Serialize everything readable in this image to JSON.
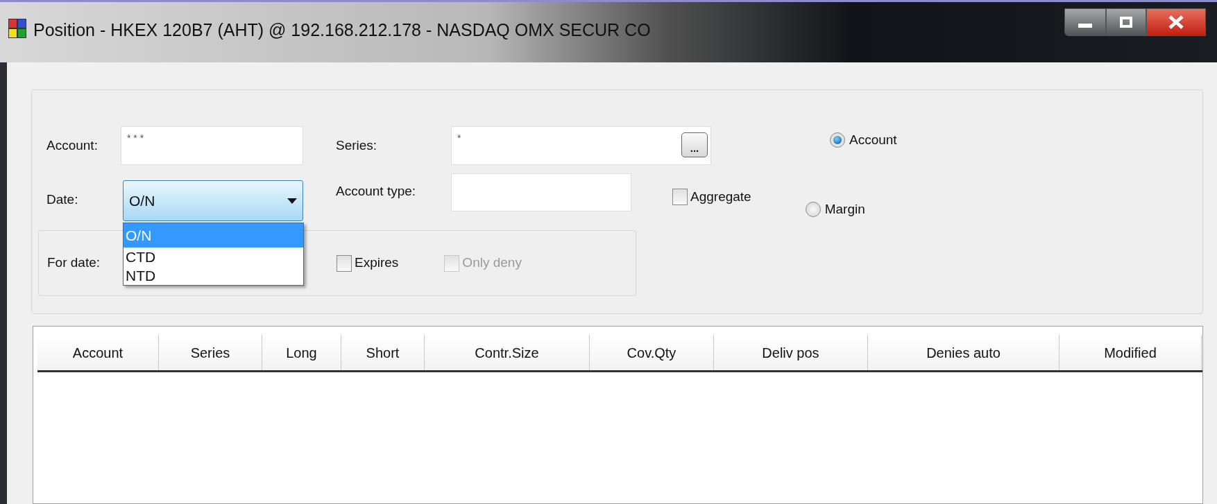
{
  "window": {
    "title": "Position - HKEX 120B7 (AHT) @ 192.168.212.178 - NASDAQ OMX SECUR CO"
  },
  "filters": {
    "account": {
      "label": "Account:",
      "value": "* * *"
    },
    "series": {
      "label": "Series:",
      "value": "*",
      "button": "..."
    },
    "date": {
      "label": "Date:",
      "value": "O/N",
      "expanded": true,
      "options": [
        {
          "label": "O/N",
          "selected": true
        },
        {
          "label": "CTD",
          "selected": false
        },
        {
          "label": "NTD",
          "selected": false
        }
      ]
    },
    "account_type": {
      "label": "Account type:"
    },
    "aggregate": {
      "label": "Aggregate",
      "checked": false,
      "disabled": false
    },
    "for_date": {
      "label": "For date:"
    },
    "expires": {
      "label": "Expires",
      "checked": false,
      "disabled": false
    },
    "only_deny": {
      "label": "Only deny",
      "checked": false,
      "disabled": true
    },
    "mode": [
      {
        "label": "Account",
        "selected": true
      },
      {
        "label": "Margin",
        "selected": false
      }
    ]
  },
  "table": {
    "columns": [
      "Account",
      "Series",
      "Long",
      "Short",
      "Contr.Size",
      "Cov.Qty",
      "Deliv pos",
      "Denies auto",
      "Modified"
    ]
  }
}
